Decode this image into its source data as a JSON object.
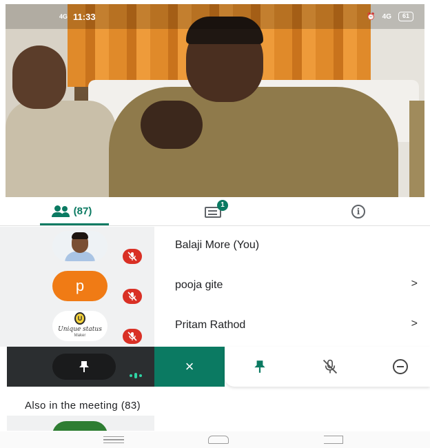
{
  "status_bar": {
    "signal_left": "4G",
    "time": "11:33",
    "network": "4G",
    "battery": "61"
  },
  "tabs": {
    "people_count": "(87)",
    "chat_badge": "1",
    "info_glyph": "i"
  },
  "participants": [
    {
      "name": "Balaji More (You)",
      "avatar_type": "photo",
      "muted": true,
      "has_chevron": false
    },
    {
      "name": "pooja gite",
      "avatar_type": "letter",
      "avatar_letter": "p",
      "muted": true,
      "has_chevron": true
    },
    {
      "name": "Pritam Rathod",
      "avatar_type": "logo",
      "logo_text": "Unique status",
      "logo_sub": "Maker",
      "muted": true,
      "has_chevron": true
    }
  ],
  "chevron": ">",
  "action_bar": {
    "close_label": "×",
    "icons": [
      "pin-icon",
      "mic-off-icon",
      "remove-icon"
    ]
  },
  "also_in_meeting": "Also in the meeting (83)",
  "colors": {
    "accent": "#0b7a62",
    "mute_red": "#d93025",
    "avatar_orange": "#f07b15",
    "dark_panel": "#2b2e30"
  }
}
